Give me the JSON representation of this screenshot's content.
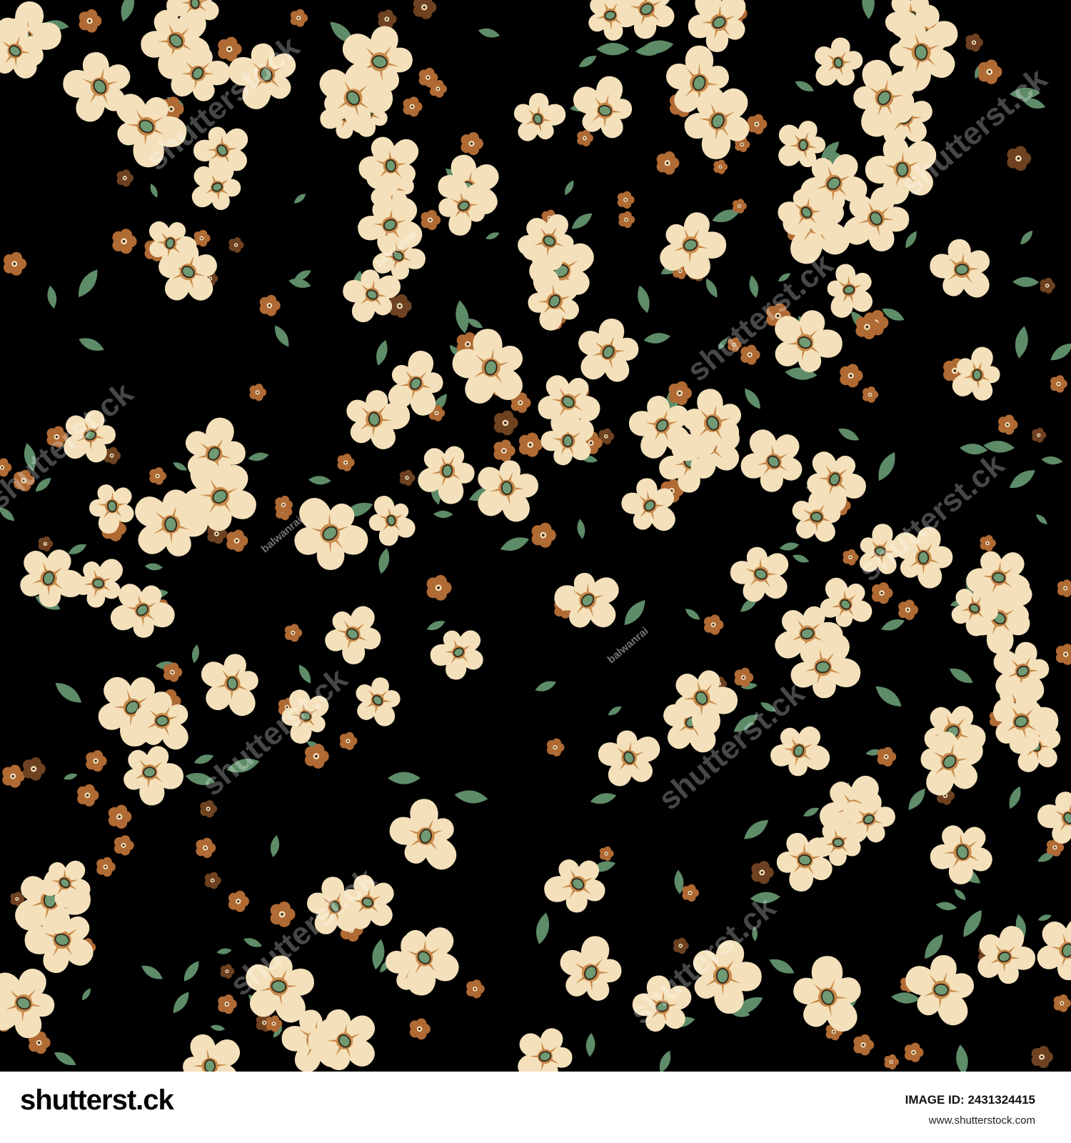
{
  "pattern": {
    "colors": {
      "background": "#000000",
      "petal": "#f4e1bb",
      "petal_streak": "#c88a4a",
      "center": "#6f9a74",
      "center_outline": "#3b2a1a",
      "blossom": "#b06a34",
      "blossom_dark": "#6e4220",
      "blossom_center": "#f4e1bb",
      "leaf": "#5e8c68"
    }
  },
  "watermarks": {
    "brand": "shutterstock",
    "brand_tiled": "shutterst.ck",
    "artist": "balwanrai"
  },
  "footer": {
    "logo": "shutterst.ck",
    "image_id_label": "IMAGE ID: 2431324415",
    "url": "www.shutterstock.com"
  }
}
